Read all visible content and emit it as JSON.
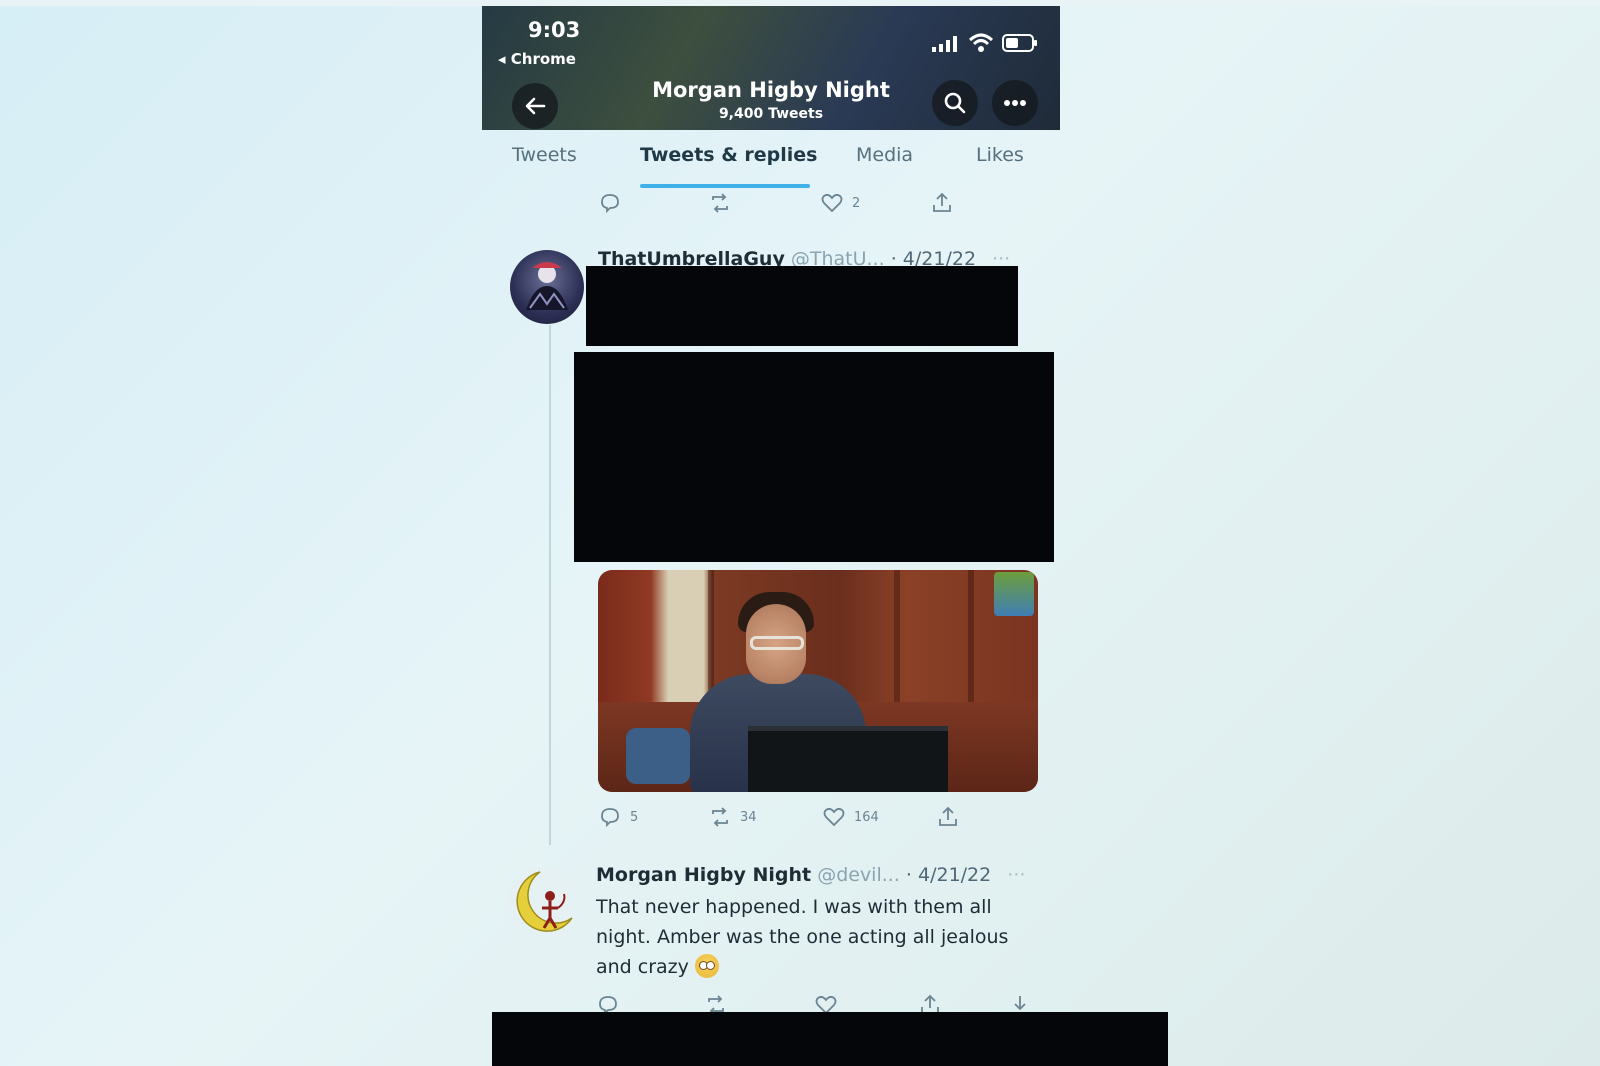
{
  "status_bar": {
    "time": "9:03",
    "back_app": "◂ Chrome"
  },
  "profile": {
    "name": "Morgan Higby Night",
    "tweet_count": "9,400 Tweets"
  },
  "tabs": [
    {
      "label": "Tweets",
      "active": false
    },
    {
      "label": "Tweets & replies",
      "active": true
    },
    {
      "label": "Media",
      "active": false
    },
    {
      "label": "Likes",
      "active": false
    }
  ],
  "top_actions": {
    "reply_count": "",
    "retweet_count": "",
    "like_count": "2"
  },
  "tweet1": {
    "author": "ThatUmbrellaGuy",
    "handle": "@ThatU...",
    "date": "· 4/21/22",
    "more": "···",
    "reply_count": "5",
    "retweet_count": "34",
    "like_count": "164"
  },
  "tweet2": {
    "author": "Morgan Higby Night",
    "handle": "@devil...",
    "date": "· 4/21/22",
    "more": "···",
    "text_line1": "That never happened. I was with them all",
    "text_line2": "night. Amber was the one acting all jealous",
    "text_line3": "and crazy"
  },
  "colors": {
    "accent": "#3fb1e8",
    "redaction": "#04060a",
    "text": "#1e2d35"
  }
}
